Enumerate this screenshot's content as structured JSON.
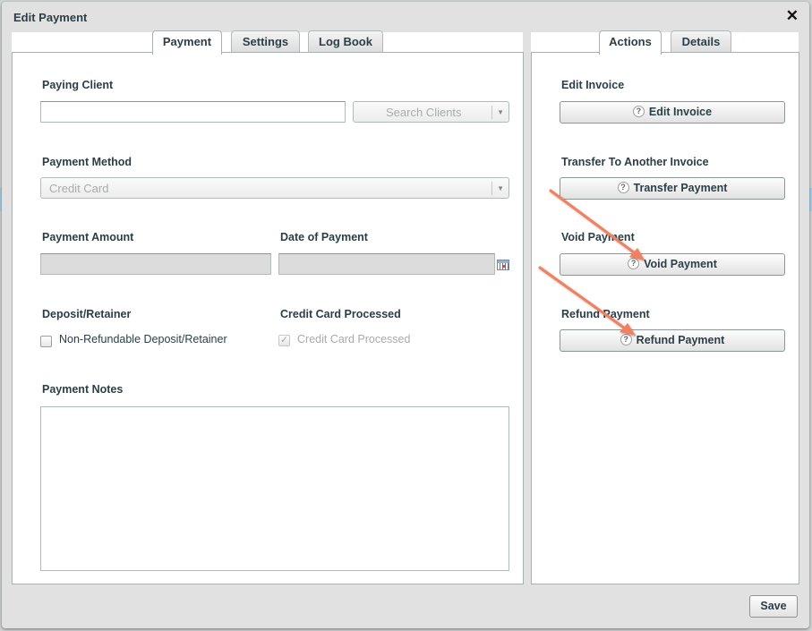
{
  "dialog": {
    "title": "Edit Payment",
    "close_icon": "close-icon"
  },
  "left_tabs": [
    {
      "label": "Payment",
      "active": true
    },
    {
      "label": "Settings",
      "active": false
    },
    {
      "label": "Log Book",
      "active": false
    }
  ],
  "right_tabs": [
    {
      "label": "Actions",
      "active": true
    },
    {
      "label": "Details",
      "active": false
    }
  ],
  "form": {
    "paying_client": {
      "label": "Paying Client",
      "value": "",
      "search_button": "Search Clients"
    },
    "payment_method": {
      "label": "Payment Method",
      "value": "Credit Card"
    },
    "payment_amount": {
      "label": "Payment Amount",
      "value": ""
    },
    "date_of_payment": {
      "label": "Date of Payment",
      "value": "",
      "icon": "calendar-icon"
    },
    "deposit_retainer": {
      "label": "Deposit/Retainer",
      "checkbox_label": "Non-Refundable Deposit/Retainer",
      "checked": false
    },
    "credit_card_processed": {
      "label": "Credit Card Processed",
      "checkbox_label": "Credit Card Processed",
      "checked": true,
      "disabled": true
    },
    "payment_notes": {
      "label": "Payment Notes",
      "value": ""
    }
  },
  "actions": [
    {
      "section": "Edit Invoice",
      "button": "Edit Invoice"
    },
    {
      "section": "Transfer To Another Invoice",
      "button": "Transfer Payment"
    },
    {
      "section": "Void Payment",
      "button": "Void Payment"
    },
    {
      "section": "Refund Payment",
      "button": "Refund Payment"
    }
  ],
  "annotations": {
    "arrow_color": "#f08060",
    "arrows_point_to": [
      "Void Payment",
      "Refund Payment"
    ]
  },
  "footer": {
    "save_label": "Save"
  }
}
